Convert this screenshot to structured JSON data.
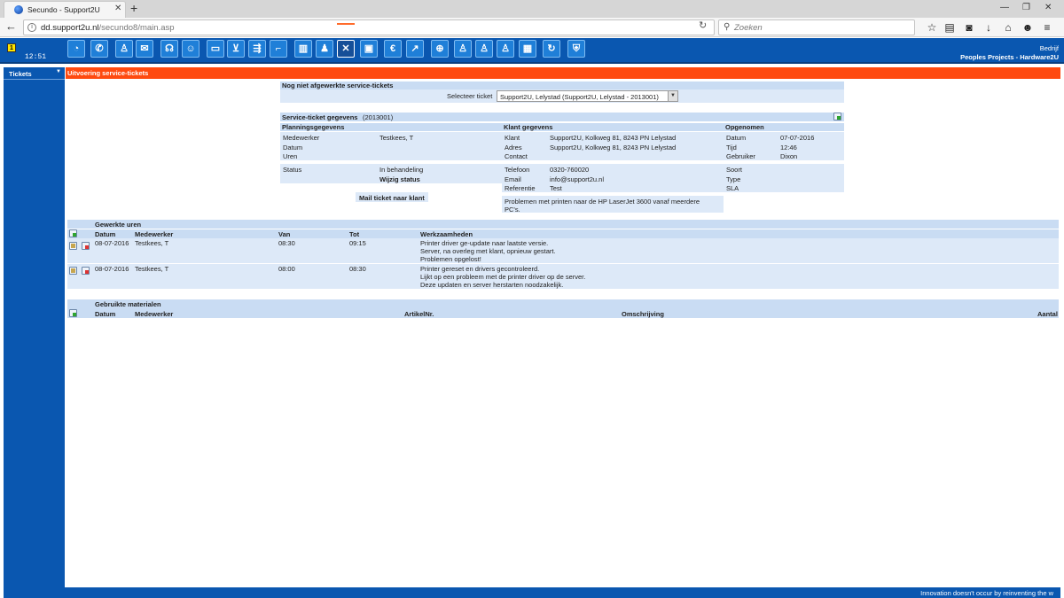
{
  "browser": {
    "tab_title": "Secundo - Support2U",
    "url_host": "dd.support2u.nl",
    "url_path": "/secundo8/main.asp",
    "search_placeholder": "Zoeken"
  },
  "app": {
    "notification_count": "1",
    "clock": "12:51",
    "company_label": "Bedrijf",
    "company_value": "Peoples Projects - Hardware2U",
    "toolbar_icons": [
      "dashboard-icon",
      "phone-icon",
      "contacts-icon",
      "mail-icon",
      "headset-icon",
      "support-agent-icon",
      "briefcase-icon",
      "cart-icon",
      "delivery-icon",
      "boots-icon",
      "book-icon",
      "team-icon",
      "tools-icon",
      "address-card-icon",
      "euro-icon",
      "growth-chart-icon",
      "globe-icon",
      "user-board-icon",
      "user-card-icon",
      "user-list-icon",
      "calendar-icon",
      "sync-icon",
      "shield-icon"
    ]
  },
  "sidebar": {
    "items": [
      {
        "label": "Tickets"
      }
    ]
  },
  "page": {
    "title": "Uitvoering service-tickets"
  },
  "pending": {
    "heading": "Nog niet afgewerkte service-tickets",
    "select_label": "Selecteer ticket",
    "selected": "Support2U, Lelystad (Support2U, Lelystad - 2013001)"
  },
  "ticket": {
    "heading": "Service-ticket gegevens",
    "number": "(2013001)",
    "planning": {
      "heading": "Planningsgegevens",
      "medewerker_label": "Medewerker",
      "medewerker": "Testkees, T",
      "datum_label": "Datum",
      "datum": "",
      "uren_label": "Uren",
      "uren": "",
      "status_label": "Status",
      "status": "In behandeling",
      "change_status": "Wijzig status",
      "mail_button": "Mail ticket naar klant"
    },
    "klant": {
      "heading": "Klant gegevens",
      "klant_label": "Klant",
      "klant": "Support2U, Kolkweg 81, 8243 PN Lelystad",
      "adres_label": "Adres",
      "adres": "Support2U, Kolkweg 81, 8243 PN Lelystad",
      "contact_label": "Contact",
      "contact": "",
      "telefoon_label": "Telefoon",
      "telefoon": "0320-760020",
      "email_label": "Email",
      "email": "info@support2u.nl",
      "referentie_label": "Referentie",
      "referentie": "Test",
      "omschrijving_line1": "Problemen met printen naar de HP LaserJet 3600 vanaf meerdere",
      "omschrijving_line2": "PC's."
    },
    "opgenomen": {
      "heading": "Opgenomen",
      "datum_label": "Datum",
      "datum": "07-07-2016",
      "tijd_label": "Tijd",
      "tijd": "12:46",
      "gebruiker_label": "Gebruiker",
      "gebruiker": "Dixon",
      "soort_label": "Soort",
      "soort": "",
      "type_label": "Type",
      "type": "",
      "sla_label": "SLA",
      "sla": ""
    }
  },
  "uren": {
    "heading": "Gewerkte uren",
    "columns": [
      "Datum",
      "Medewerker",
      "Van",
      "Tot",
      "Werkzaamheden"
    ],
    "rows": [
      {
        "datum": "08-07-2016",
        "medewerker": "Testkees, T",
        "van": "08:30",
        "tot": "09:15",
        "lines": [
          "Printer driver ge-update naar laatste versie.",
          "Server, na overleg met klant, opnieuw gestart.",
          "Problemen opgelost!"
        ]
      },
      {
        "datum": "08-07-2016",
        "medewerker": "Testkees, T",
        "van": "08:00",
        "tot": "08:30",
        "lines": [
          "Printer gereset en drivers gecontroleerd.",
          "Lijkt op een probleem met de printer driver op de server.",
          "Deze updaten en server herstarten noodzakelijk."
        ]
      }
    ]
  },
  "materialen": {
    "heading": "Gebruikte materialen",
    "columns": [
      "Datum",
      "Medewerker",
      "ArtikelNr.",
      "Omschrijving",
      "Aantal"
    ]
  },
  "statusbar": {
    "text": "Innovation doesn't occur by reinventing the w"
  }
}
